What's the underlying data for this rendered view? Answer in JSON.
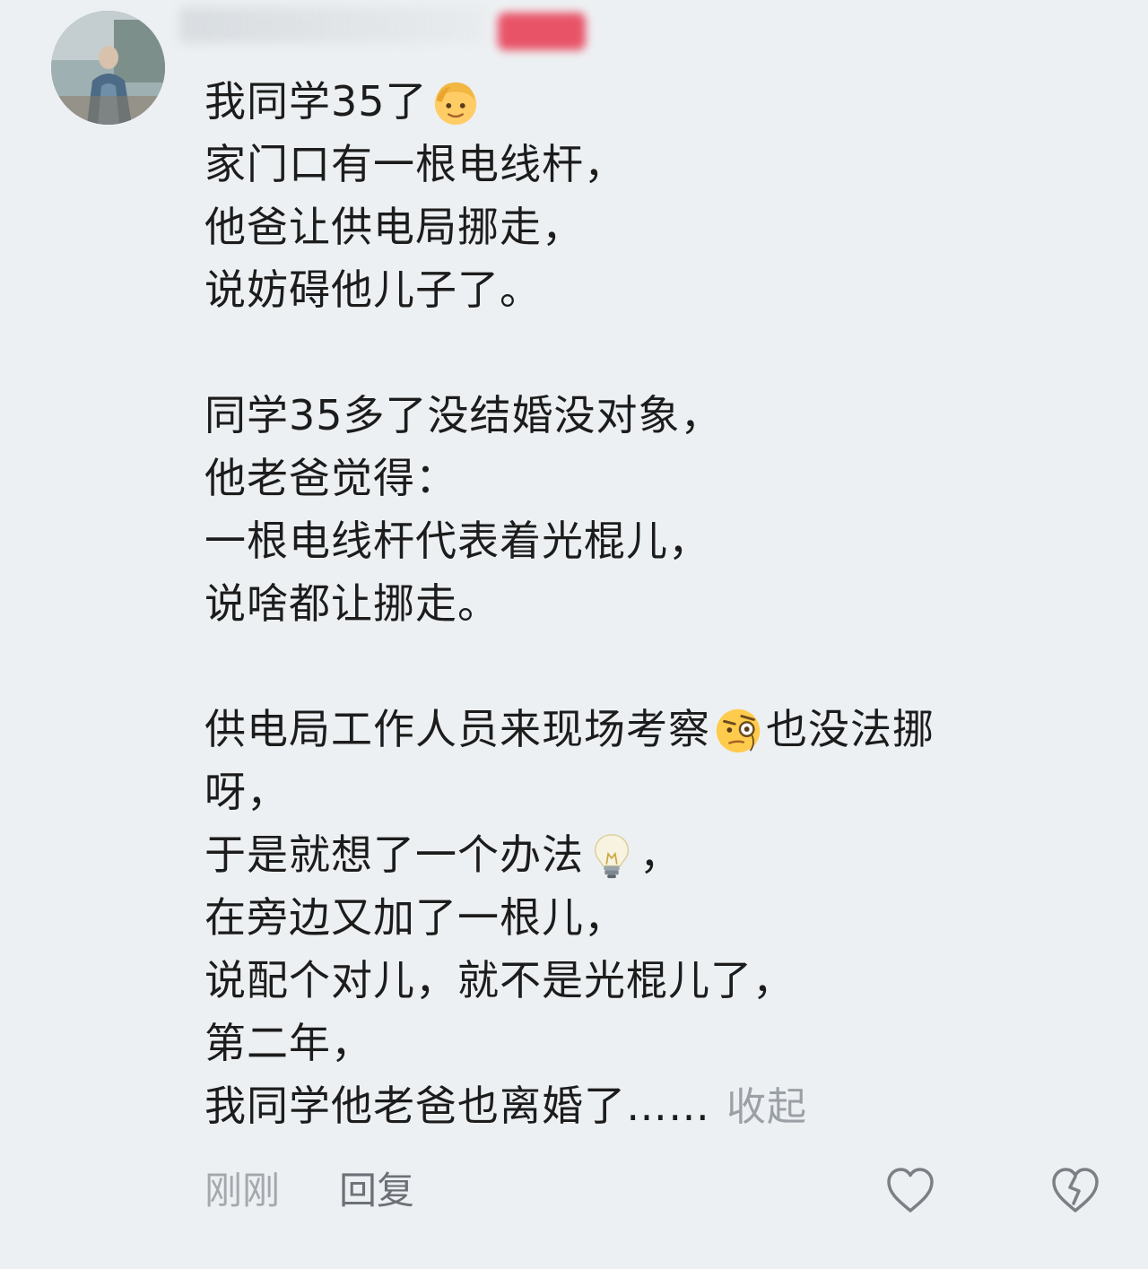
{
  "comment": {
    "username": "",
    "author_badge": "",
    "lines": {
      "l1": "我同学35了",
      "l2": "家门口有一根电线杆，",
      "l3": "他爸让供电局挪走，",
      "l4": "说妨碍他儿子了。",
      "l5": "同学35多了没结婚没对象，",
      "l6": "他老爸觉得：",
      "l7": "一根电线杆代表着光棍儿，",
      "l8": "说啥都让挪走。",
      "l9a": "供电局工作人员来现场考察",
      "l9b": "也没法挪",
      "l10": "呀，",
      "l11a": "于是就想了一个办法",
      "l11b": "，",
      "l12": "在旁边又加了一根儿，",
      "l13": "说配个对儿，就不是光棍儿了，",
      "l14": "第二年，",
      "l15": "我同学他老爸也离婚了……"
    },
    "collapse_label": "收起",
    "emojis": [
      "blond-person-emoji",
      "face-with-monocle-emoji",
      "light-bulb-emoji"
    ]
  },
  "footer": {
    "time": "刚刚",
    "reply_label": "回复",
    "like_icon": "heart-outline-icon",
    "dislike_icon": "broken-heart-outline-icon"
  },
  "colors": {
    "background": "#edf0f2",
    "text": "#1c1c1c",
    "muted": "#a3a8ad",
    "reply": "#6b7177",
    "badge": "#e8384f"
  }
}
